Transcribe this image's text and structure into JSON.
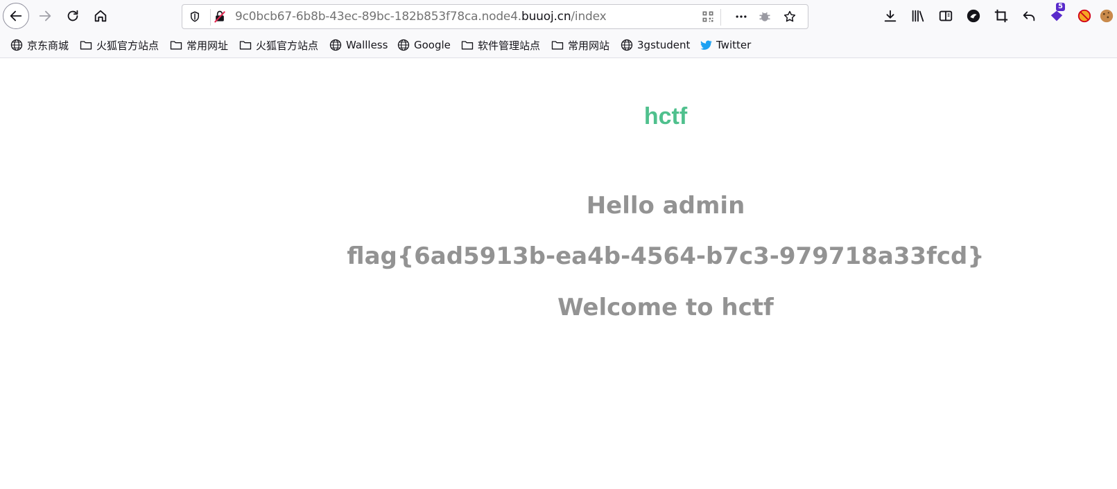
{
  "browser": {
    "url_prefix": "9c0bcb67-6b8b-43ec-89bc-182b853f78ca.node4.",
    "url_domain": "buuoj.cn",
    "url_path": "/index",
    "extension_badge": "5"
  },
  "bookmarks": [
    {
      "label": "京东商城",
      "icon": "globe-icon"
    },
    {
      "label": "火狐官方站点",
      "icon": "folder-icon"
    },
    {
      "label": "常用网址",
      "icon": "folder-icon"
    },
    {
      "label": "火狐官方站点",
      "icon": "folder-icon"
    },
    {
      "label": "Wallless",
      "icon": "globe-icon"
    },
    {
      "label": "Google",
      "icon": "globe-icon"
    },
    {
      "label": "软件管理站点",
      "icon": "folder-icon"
    },
    {
      "label": "常用网站",
      "icon": "folder-icon"
    },
    {
      "label": "3gstudent",
      "icon": "globe-icon"
    },
    {
      "label": "Twitter",
      "icon": "twitter-icon"
    }
  ],
  "page": {
    "brand": "hctf",
    "greeting": "Hello admin",
    "flag": "flag{6ad5913b-ea4b-4564-b7c3-979718a33fcd}",
    "welcome": "Welcome to hctf"
  },
  "colors": {
    "brand": "#4fc08d",
    "text": "#939393",
    "accent_badge": "#592acb"
  }
}
